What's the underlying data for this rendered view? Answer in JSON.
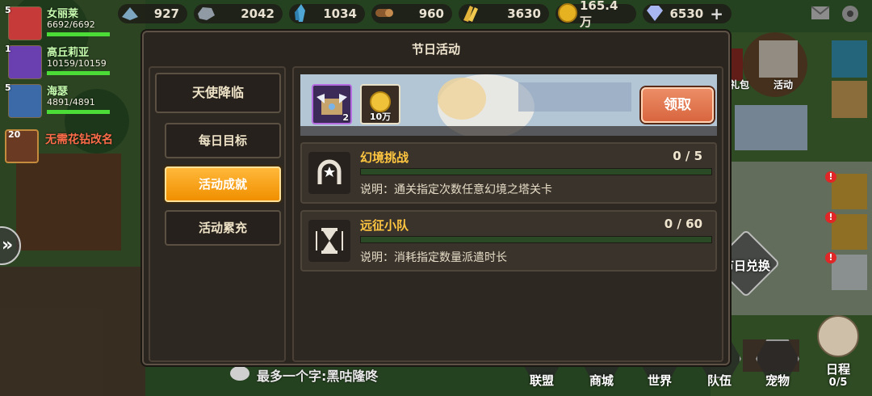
{
  "resources": [
    {
      "name": "wood",
      "value": "927",
      "width": 86
    },
    {
      "name": "stone",
      "value": "2042",
      "width": 110
    },
    {
      "name": "crystal",
      "value": "1034",
      "width": 94
    },
    {
      "name": "log",
      "value": "960",
      "width": 100
    },
    {
      "name": "wheat",
      "value": "3630",
      "width": 112
    },
    {
      "name": "gold",
      "value": "165.4万",
      "width": 100
    },
    {
      "name": "diamond",
      "value": "6530",
      "width": 110
    }
  ],
  "heroes": [
    {
      "level": "5",
      "name": "女丽莱",
      "hp": "6692/6692",
      "color": "#c63a3a"
    },
    {
      "level": "1",
      "name": "高丘莉亚",
      "hp": "10159/10159",
      "color": "#6a3fb0"
    },
    {
      "level": "5",
      "name": "海瑟",
      "hp": "4891/4891",
      "color": "#3c6aa8"
    }
  ],
  "rename": {
    "level": "20",
    "text": "无需花钻改名"
  },
  "side": {
    "gift": "礼包",
    "activity": "活动",
    "exchange": "节日兑换"
  },
  "dialog": {
    "title": "节日活动",
    "main_tab": "天使降临",
    "sub_tabs": [
      "每日目标",
      "活动成就",
      "活动累充"
    ],
    "active_index": 1
  },
  "banner": {
    "slot1_count": "2",
    "slot2_count": "10万",
    "claim_label": "领取"
  },
  "tasks": [
    {
      "name": "幻境挑战",
      "progress": "0 / 5",
      "fraction": 0,
      "desc": "说明：通关指定次数任意幻境之塔关卡",
      "icon": "horseshoe-icon"
    },
    {
      "name": "远征小队",
      "progress": "0 / 60",
      "fraction": 0,
      "desc": "说明：消耗指定数量派遣时长",
      "icon": "hourglass-icon"
    }
  ],
  "chat": "最多一个字:黑咕隆咚",
  "nav": [
    "联盟",
    "商城",
    "世界",
    "队伍",
    "宠物"
  ],
  "schedule": {
    "label": "日程",
    "count": "0/5"
  },
  "colors": {
    "accent": "#f09000",
    "task_name": "#ffc640",
    "claim": "#d8663f"
  }
}
